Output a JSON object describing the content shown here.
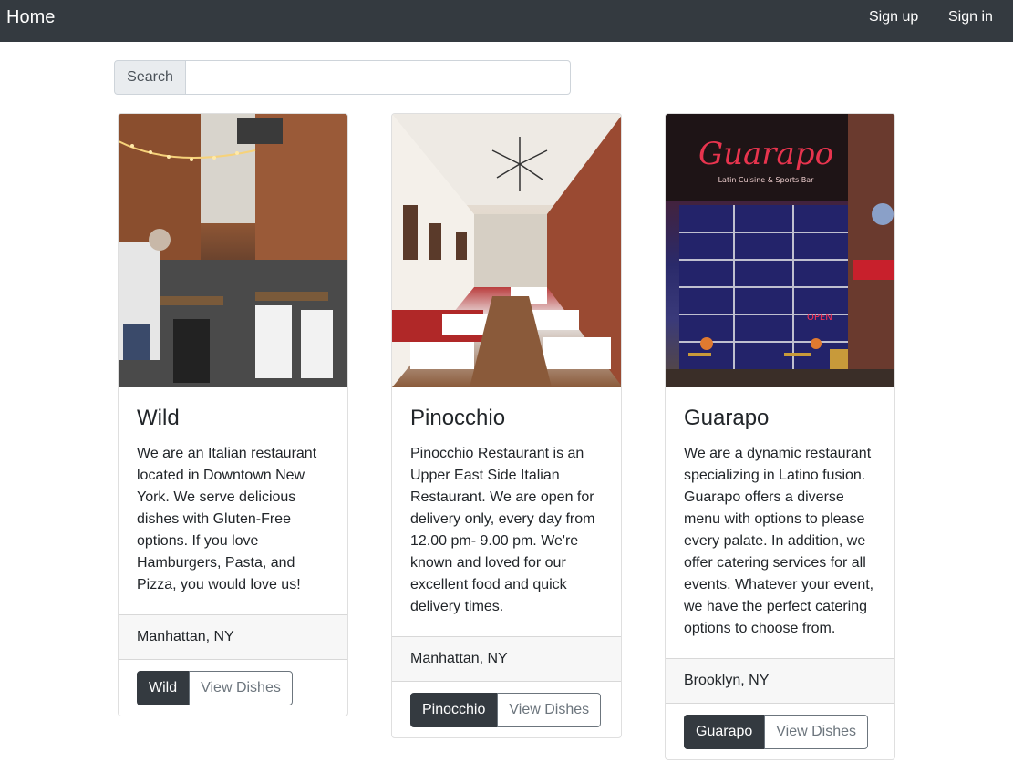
{
  "nav": {
    "brand": "Home",
    "signup": "Sign up",
    "signin": "Sign in"
  },
  "search": {
    "label": "Search",
    "value": "",
    "placeholder": ""
  },
  "restaurants": [
    {
      "name": "Wild",
      "description": "We are an Italian restaurant located in Downtown New York. We serve delicious dishes with Gluten-Free options. If you love Hamburgers, Pasta, and Pizza, you would love us!",
      "location": "Manhattan, NY",
      "name_button": "Wild",
      "view_button": "View Dishes"
    },
    {
      "name": "Pinocchio",
      "description": "Pinocchio Restaurant is an Upper East Side Italian Restaurant. We are open for delivery only, every day from 12.00 pm- 9.00 pm. We're known and loved for our excellent food and quick delivery times.",
      "location": "Manhattan, NY",
      "name_button": "Pinocchio",
      "view_button": "View Dishes"
    },
    {
      "name": "Guarapo",
      "description": "We are a dynamic restaurant specializing in Latino fusion. Guarapo offers a diverse menu with options to please every palate. In addition, we offer catering services for all events. Whatever your event, we have the perfect catering options to choose from.",
      "location": "Brooklyn, NY",
      "name_button": "Guarapo",
      "view_button": "View Dishes",
      "sign_text": "Guarapo",
      "sign_subtext": "Latin Cuisine & Sports Bar",
      "open_sign": "OPEN"
    }
  ],
  "colors": {
    "navbar": "#343a40",
    "button_dark": "#343a40",
    "card_footer": "#f7f7f7"
  }
}
